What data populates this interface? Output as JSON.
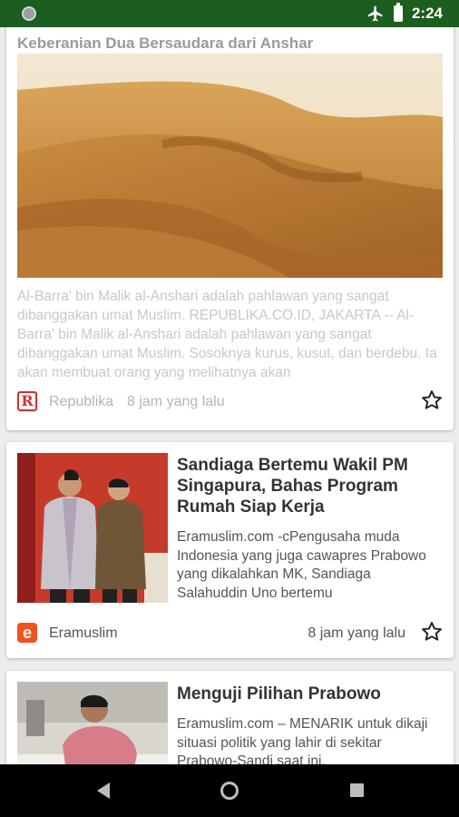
{
  "status_bar": {
    "time": "2:24"
  },
  "articles": [
    {
      "title": "Keberanian Dua Bersaudara dari Anshar",
      "snippet": "Al-Barra' bin Malik al-Anshari adalah pahlawan yang sangat dibanggakan umat Muslim.   REPUBLIKA.CO.ID,  JAKARTA -- Al-Barra' bin Malik al-Anshari adalah pahlawan yang sangat dibanggakan umat Muslim. Sosoknya kurus, kusut, dan berdebu. Ia akan membuat orang yang melihatnya akan",
      "source": "Republika",
      "time": "8 jam yang lalu",
      "source_logo": "republika-logo",
      "read": true
    },
    {
      "title": "Sandiaga Bertemu Wakil PM Singapura, Bahas Program Rumah Siap Kerja",
      "snippet": "Eramuslim.com -cPengusaha muda Indonesia yang juga cawapres Prabowo yang dikalahkan MK, Sandiaga Salahuddin Uno bertemu",
      "source": "Eramuslim",
      "time": "8 jam yang lalu",
      "source_logo": "eramuslim-logo"
    },
    {
      "title": "Menguji Pilihan Prabowo",
      "snippet": "Eramuslim.com – MENARIK untuk dikaji situasi politik yang lahir di sekitar Prabowo-Sandi saat ini."
    }
  ],
  "icons": {
    "bookmark": "star-outline-icon",
    "airplane": "airplane-mode-icon",
    "battery": "battery-icon"
  },
  "colors": {
    "status_bar": "#1b5e20",
    "republika": "#d32f2f",
    "eramuslim": "#f4511e"
  }
}
